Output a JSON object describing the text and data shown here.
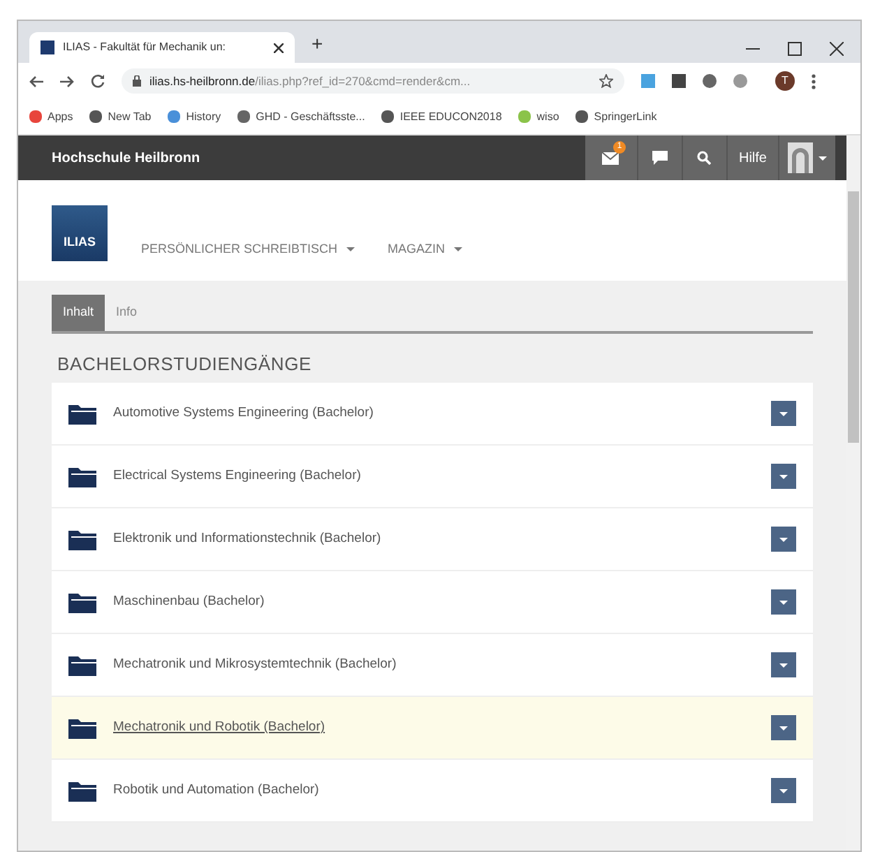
{
  "browser": {
    "tab_title": "ILIAS - Fakultät für Mechanik un:",
    "new_tab": "+",
    "url_host": "ilias.hs-heilbronn.de",
    "url_path": "/ilias.php?ref_id=270&cmd=render&cm...",
    "profile_initial": "T",
    "bookmarks": [
      "Apps",
      "New Tab",
      "History",
      "GHD - Geschäftsste...",
      "IEEE EDUCON2018",
      "wiso",
      "SpringerLink"
    ]
  },
  "header": {
    "title": "Hochschule Heilbronn",
    "mail_count": "1",
    "help": "Hilfe"
  },
  "logo": "ILIAS",
  "menu": [
    "PERSÖNLICHER SCHREIBTISCH",
    "MAGAZIN"
  ],
  "tabs": [
    {
      "label": "Inhalt",
      "selected": true
    },
    {
      "label": "Info",
      "selected": false
    }
  ],
  "section_title": "BACHELORSTUDIENGÄNGE",
  "items": [
    {
      "label": "Automotive Systems Engineering (Bachelor)",
      "selected": false
    },
    {
      "label": "Electrical Systems Engineering (Bachelor)",
      "selected": false
    },
    {
      "label": "Elektronik und Informationstechnik (Bachelor)",
      "selected": false
    },
    {
      "label": "Maschinenbau (Bachelor)",
      "selected": false
    },
    {
      "label": "Mechatronik und Mikrosystemtechnik (Bachelor)",
      "selected": false
    },
    {
      "label": "Mechatronik und Robotik (Bachelor)",
      "selected": true
    },
    {
      "label": "Robotik und Automation (Bachelor)",
      "selected": false
    }
  ]
}
